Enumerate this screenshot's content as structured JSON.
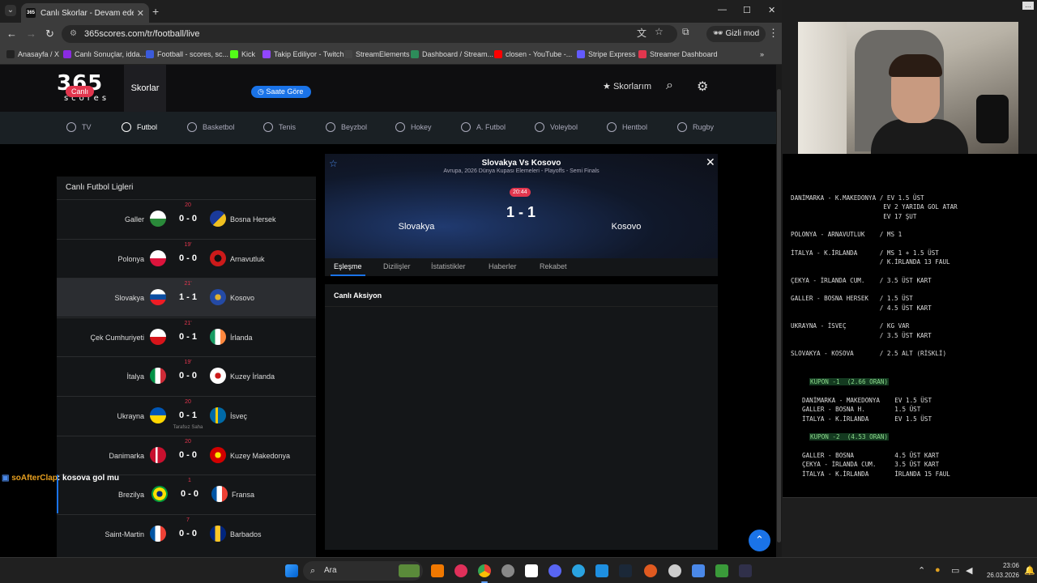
{
  "browser": {
    "tab_title": "Canlı Skorlar - Devam eden maç",
    "tab_favicon": "365",
    "url": "365scores.com/tr/football/live",
    "incognito_label": "Gizli mod",
    "bookmarks": [
      {
        "label": "Anasayfa / X",
        "color": "#222222"
      },
      {
        "label": "Canlı Sonuçlar, idda...",
        "color": "#8a2be2"
      },
      {
        "label": "Football - scores, sc...",
        "color": "#3b5bdb"
      },
      {
        "label": "Kick",
        "color": "#53fc18"
      },
      {
        "label": "Takip Ediliyor - Twitch",
        "color": "#9146ff"
      },
      {
        "label": "StreamElements",
        "color": "#444444"
      },
      {
        "label": "Dashboard / Stream...",
        "color": "#2d8c5a"
      },
      {
        "label": "closen - YouTube -...",
        "color": "#ff0000"
      },
      {
        "label": "Stripe Express",
        "color": "#635bff"
      },
      {
        "label": "Streamer Dashboard",
        "color": "#e2364e"
      }
    ]
  },
  "site": {
    "logo_number": "365",
    "logo_text": "scores",
    "nav_skorlar": "Skorlar",
    "skorlarim": "Skorlarım",
    "sports": [
      "TV",
      "Futbol",
      "Basketbol",
      "Tenis",
      "Beyzbol",
      "Hokey",
      "A. Futbol",
      "Voleybol",
      "Hentbol",
      "Rugby"
    ],
    "live_badge": "Canlı",
    "by_time_button": "Saate Göre",
    "leagues_title": "Canlı Futbol Ligleri",
    "matches": [
      {
        "minute": "20",
        "home": "Galler",
        "away": "Bosna Hersek",
        "score": "0 - 0",
        "hflag": "wales",
        "aflag": "bosnia",
        "note": ""
      },
      {
        "minute": "19'",
        "home": "Polonya",
        "away": "Arnavutluk",
        "score": "0 - 0",
        "hflag": "poland",
        "aflag": "albania",
        "note": ""
      },
      {
        "minute": "21'",
        "home": "Slovakya",
        "away": "Kosovo",
        "score": "1 - 1",
        "hflag": "slovakia",
        "aflag": "kosovo",
        "note": ""
      },
      {
        "minute": "21'",
        "home": "Çek Cumhuriyeti",
        "away": "İrlanda",
        "score": "0 - 1",
        "hflag": "czech",
        "aflag": "ireland",
        "note": ""
      },
      {
        "minute": "19'",
        "home": "İtalya",
        "away": "Kuzey İrlanda",
        "score": "0 - 0",
        "hflag": "italy",
        "aflag": "nireland",
        "note": ""
      },
      {
        "minute": "20",
        "home": "Ukrayna",
        "away": "İsveç",
        "score": "0 - 1",
        "hflag": "ukraine",
        "aflag": "sweden",
        "note": "Tarafsız Saha"
      },
      {
        "minute": "20",
        "home": "Danimarka",
        "away": "Kuzey Makedonya",
        "score": "0 - 0",
        "hflag": "denmark",
        "aflag": "macedonia",
        "note": ""
      },
      {
        "minute": "1",
        "home": "Brezilya",
        "away": "Fransa",
        "score": "0 - 0",
        "hflag": "brazil",
        "aflag": "france",
        "note": ""
      },
      {
        "minute": "7",
        "home": "Saint-Martin",
        "away": "Barbados",
        "score": "0 - 0",
        "hflag": "france",
        "aflag": "barbados",
        "note": ""
      }
    ],
    "detail": {
      "title": "Slovakya Vs Kosovo",
      "subtitle": "Avrupa, 2026 Dünya Kupası Elemeleri - Playoffs - Semi Finals",
      "time": "20:44",
      "score": "1 - 1",
      "home": "Slovakya",
      "away": "Kosovo",
      "tabs": [
        "Eşleşme",
        "Dizilişler",
        "İstatistikler",
        "Haberler",
        "Rekabet"
      ],
      "live_action_title": "Canlı Aksiyon"
    }
  },
  "chat": {
    "user": "soAfterClap",
    "message": ": kosova gol mu"
  },
  "notes": [
    "DANİMARKA - K.MAKEDONYA / EV 1.5 ÜST",
    "                         EV 2 YARIDA GOL ATAR",
    "                         EV 17 ŞUT",
    "",
    "POLONYA - ARNAVUTLUK    / MS 1",
    "",
    "İTALYA - K.İRLANDA      / MS 1 + 1.5 ÜST",
    "                        / K.İRLANDA 13 FAUL",
    "",
    "ÇEKYA - İRLANDA CUM.    / 3.5 ÜST KART",
    "",
    "GALLER - BOSNA HERSEK   / 1.5 ÜST",
    "                        / 4.5 ÜST KART",
    "",
    "UKRAYNA - İSVEÇ         / KG VAR",
    "                        / 3.5 ÜST KART",
    "",
    "SLOVAKYA - KOSOVA       / 2.5 ALT (RİSKLİ)"
  ],
  "kupon1": {
    "title": "KUPON -1  (2.66 ORAN)",
    "lines": [
      "DANİMARKA - MAKEDONYA    EV 1.5 ÜST",
      "GALLER - BOSNA H.        1.5 ÜST",
      "İTALYA - K.İRLANDA       EV 1.5 ÜST"
    ]
  },
  "kupon2": {
    "title": "KUPON -2  (4.53 ORAN)",
    "lines": [
      "GALLER - BOSNA           4.5 ÜST KART",
      "ÇEKYA - İRLANDA CUM.     3.5 ÜST KART",
      "İTALYA - K.İRLANDA       İRLANDA 15 FAUL"
    ]
  },
  "taskbar": {
    "search_placeholder": "Ara",
    "time": "23:06",
    "date": "26.03.2026"
  }
}
